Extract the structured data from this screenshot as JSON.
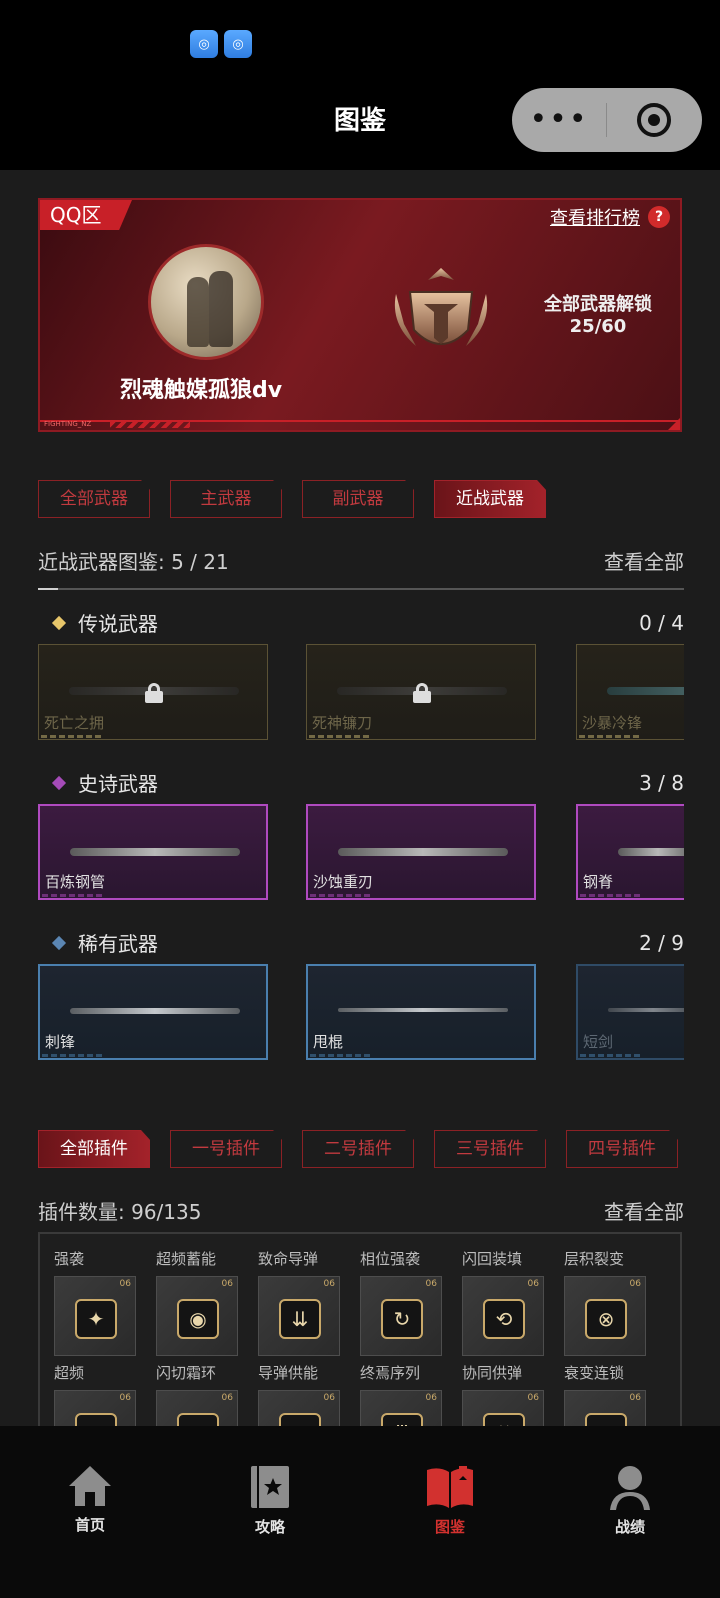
{
  "header": {
    "title": "图鉴",
    "status_icons": [
      "wifi-app-icon",
      "wifi-app-icon"
    ],
    "capsule": {
      "more": "•••",
      "close": "target"
    }
  },
  "profile": {
    "region": "QQ区",
    "rank_link": "查看排行榜",
    "help": "?",
    "player_name": "烈魂触媒孤狼dv",
    "unlock_label": "全部武器解锁",
    "unlock_count": "25/60",
    "footer_tag": "FIGHTING_NZ"
  },
  "weapon_tabs": [
    {
      "label": "全部武器",
      "active": false
    },
    {
      "label": "主武器",
      "active": false
    },
    {
      "label": "副武器",
      "active": false
    },
    {
      "label": "近战武器",
      "active": true
    }
  ],
  "weapon_summary": {
    "title": "近战武器图鉴: 5 / 21",
    "view_all": "查看全部"
  },
  "rarities": [
    {
      "label": "传说武器",
      "count": "0 / 4",
      "color": "#e7c66a",
      "weapons": [
        {
          "name": "死亡之拥",
          "locked": true
        },
        {
          "name": "死神镰刀",
          "locked": true
        },
        {
          "name": "沙暴冷锋",
          "locked": false
        }
      ]
    },
    {
      "label": "史诗武器",
      "count": "3 / 8",
      "color": "#a54bb8",
      "weapons": [
        {
          "name": "百炼钢管",
          "locked": false
        },
        {
          "name": "沙蚀重刃",
          "locked": false
        },
        {
          "name": "钢脊",
          "locked": false
        }
      ]
    },
    {
      "label": "稀有武器",
      "count": "2 / 9",
      "color": "#5b86b3",
      "weapons": [
        {
          "name": "刺锋",
          "locked": false
        },
        {
          "name": "甩棍",
          "locked": false
        },
        {
          "name": "短剑",
          "locked": false
        }
      ]
    }
  ],
  "plugin_tabs": [
    {
      "label": "全部插件",
      "active": true
    },
    {
      "label": "一号插件",
      "active": false
    },
    {
      "label": "二号插件",
      "active": false
    },
    {
      "label": "三号插件",
      "active": false
    },
    {
      "label": "四号插件",
      "active": false
    }
  ],
  "plugin_summary": {
    "title": "插件数量: 96/135",
    "view_all": "查看全部"
  },
  "plugins": [
    {
      "name": "强袭",
      "level": "06"
    },
    {
      "name": "超频蓄能",
      "level": "06"
    },
    {
      "name": "致命导弹",
      "level": "06"
    },
    {
      "name": "相位强袭",
      "level": "06"
    },
    {
      "name": "闪回装填",
      "level": "06"
    },
    {
      "name": "层积裂变",
      "level": "06"
    },
    {
      "name": "超频",
      "level": "06"
    },
    {
      "name": "闪切霜环",
      "level": "06"
    },
    {
      "name": "导弹供能",
      "level": "06"
    },
    {
      "name": "终焉序列",
      "level": "06"
    },
    {
      "name": "协同供弹",
      "level": "06"
    },
    {
      "name": "衰变连锁",
      "level": "06"
    }
  ],
  "bottom_nav": [
    {
      "label": "首页",
      "icon": "home-icon",
      "active": false
    },
    {
      "label": "攻略",
      "icon": "guide-book-icon",
      "active": false
    },
    {
      "label": "图鉴",
      "icon": "codex-book-icon",
      "active": true
    },
    {
      "label": "战绩",
      "icon": "user-icon",
      "active": false
    }
  ],
  "colors": {
    "accent": "#c82028",
    "active_nav": "#d2312f"
  }
}
